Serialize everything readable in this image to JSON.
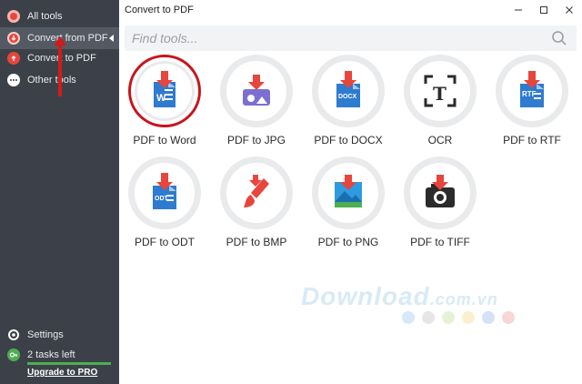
{
  "sidebar": {
    "items": [
      {
        "label": "All tools"
      },
      {
        "label": "Convert from PDF"
      },
      {
        "label": "Convert to PDF"
      },
      {
        "label": "Other tools"
      }
    ],
    "settings": "Settings",
    "tasks_left": "2 tasks left",
    "upgrade": "Upgrade to PRO"
  },
  "window": {
    "title": "Convert to PDF"
  },
  "search": {
    "placeholder": "Find tools..."
  },
  "tools": [
    {
      "label": "PDF to Word",
      "tag": "W"
    },
    {
      "label": "PDF to JPG",
      "tag": ""
    },
    {
      "label": "PDF to DOCX",
      "tag": "DOCX"
    },
    {
      "label": "OCR",
      "tag": "T"
    },
    {
      "label": "PDF to RTF",
      "tag": "RTF"
    },
    {
      "label": "PDF to ODT",
      "tag": "ODT"
    },
    {
      "label": "PDF to BMP",
      "tag": ""
    },
    {
      "label": "PDF to PNG",
      "tag": ""
    },
    {
      "label": "PDF to TIFF",
      "tag": ""
    }
  ],
  "watermark": {
    "main": "Download",
    "suffix": ".com.vn"
  },
  "colors": {
    "accent_red": "#e8453c",
    "doc_blue": "#2e7bcf",
    "highlight": "#c8141c",
    "progress": "#4caf50"
  }
}
